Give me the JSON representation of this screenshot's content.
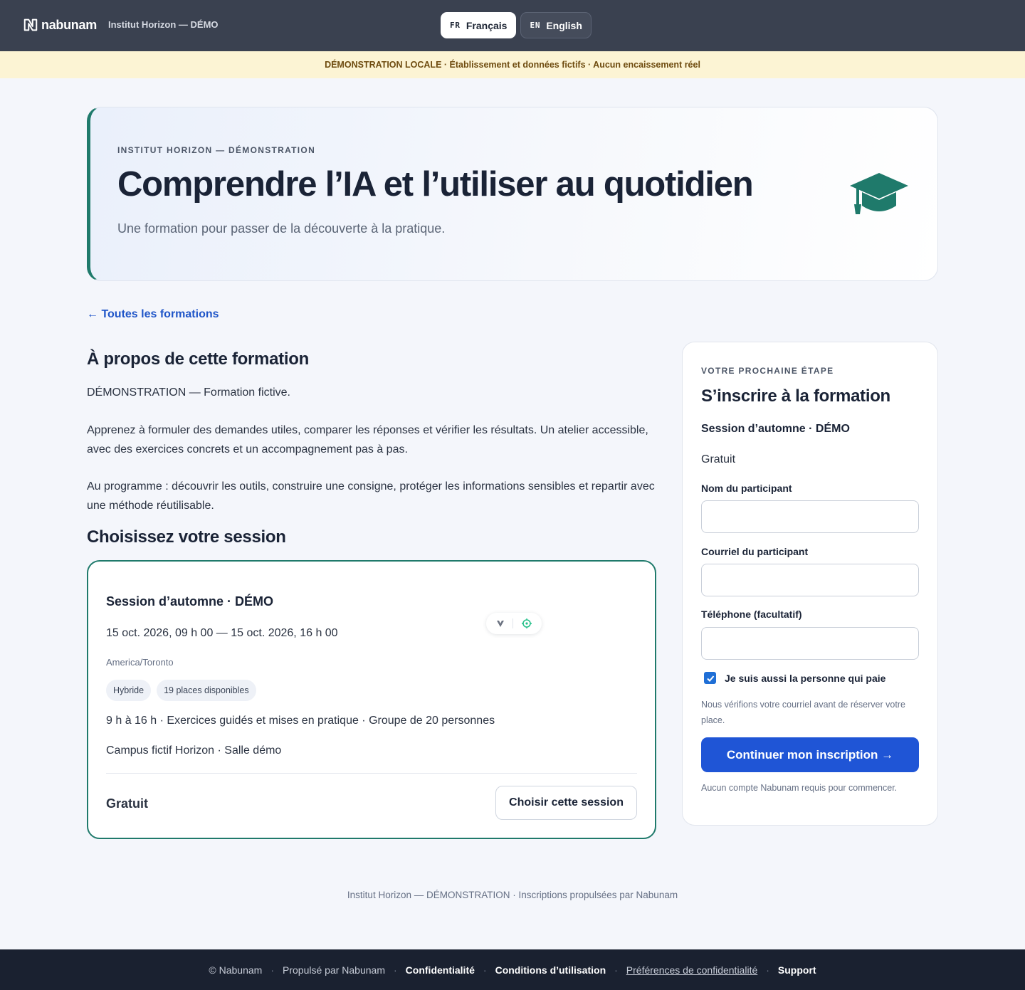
{
  "header": {
    "brand": "nabunam",
    "org": "Institut Horizon — DÉMO",
    "languages": [
      {
        "code": "FR",
        "label": "Français",
        "active": true
      },
      {
        "code": "EN",
        "label": "English",
        "active": false
      }
    ]
  },
  "banner": "DÉMONSTRATION LOCALE · Établissement et données fictifs · Aucun encaissement réel",
  "hero": {
    "eyebrow": "INSTITUT HORIZON — DÉMONSTRATION",
    "title": "Comprendre l’IA et l’utiliser au quotidien",
    "subtitle": "Une formation pour passer de la découverte à la pratique.",
    "icon": "graduation-cap-icon",
    "accent": "#1f7a6b"
  },
  "nav": {
    "back": "← Toutes les formations"
  },
  "about": {
    "title": "À propos de cette formation",
    "paragraphs": [
      "DÉMONSTRATION — Formation fictive.",
      "Apprenez à formuler des demandes utiles, comparer les réponses et vérifier les résultats. Un atelier accessible, avec des exercices concrets et un accompagnement pas à pas.",
      "Au programme : découvrir les outils, construire une consigne, protéger les informations sensibles et repartir avec une méthode réutilisable."
    ]
  },
  "sessions": {
    "title": "Choisissez votre session",
    "items": [
      {
        "name": "Session d’automne · DÉMO",
        "dates": "15 oct. 2026, 09 h 00 — 15 oct. 2026, 16 h 00",
        "timezone": "America/Toronto",
        "chips": [
          "Hybride",
          "19 places disponibles"
        ],
        "details": "9 h à 16 h · Exercices guidés et mises en pratique · Groupe de 20 personnes",
        "location": "Campus fictif Horizon · Salle démo",
        "price": "Gratuit",
        "choose_label": "Choisir cette session"
      }
    ]
  },
  "form": {
    "eyebrow": "VOTRE PROCHAINE ÉTAPE",
    "title": "S’inscrire à la formation",
    "session": "Session d’automne · DÉMO",
    "price": "Gratuit",
    "fields": [
      {
        "label": "Nom du participant",
        "value": "",
        "placeholder": ""
      },
      {
        "label": "Courriel du participant",
        "value": "",
        "placeholder": ""
      },
      {
        "label": "Téléphone (facultatif)",
        "value": "",
        "placeholder": ""
      }
    ],
    "payer_checkbox": {
      "label": "Je suis aussi la personne qui paie",
      "checked": true
    },
    "note": "Nous vérifions votre courriel avant de réserver votre place.",
    "submit": "Continuer mon inscription →",
    "footnote": "Aucun compte Nabunam requis pour commencer.",
    "primary_color": "#1f55d6"
  },
  "credit": "Institut Horizon — DÉMONSTRATION · Inscriptions propulsées par Nabunam",
  "footer": {
    "copyright": "© Nabunam",
    "powered": "Propulsé par Nabunam",
    "privacy": "Confidentialité",
    "terms": "Conditions d’utilisation",
    "preferences": "Préférences de confidentialité",
    "support": "Support"
  }
}
